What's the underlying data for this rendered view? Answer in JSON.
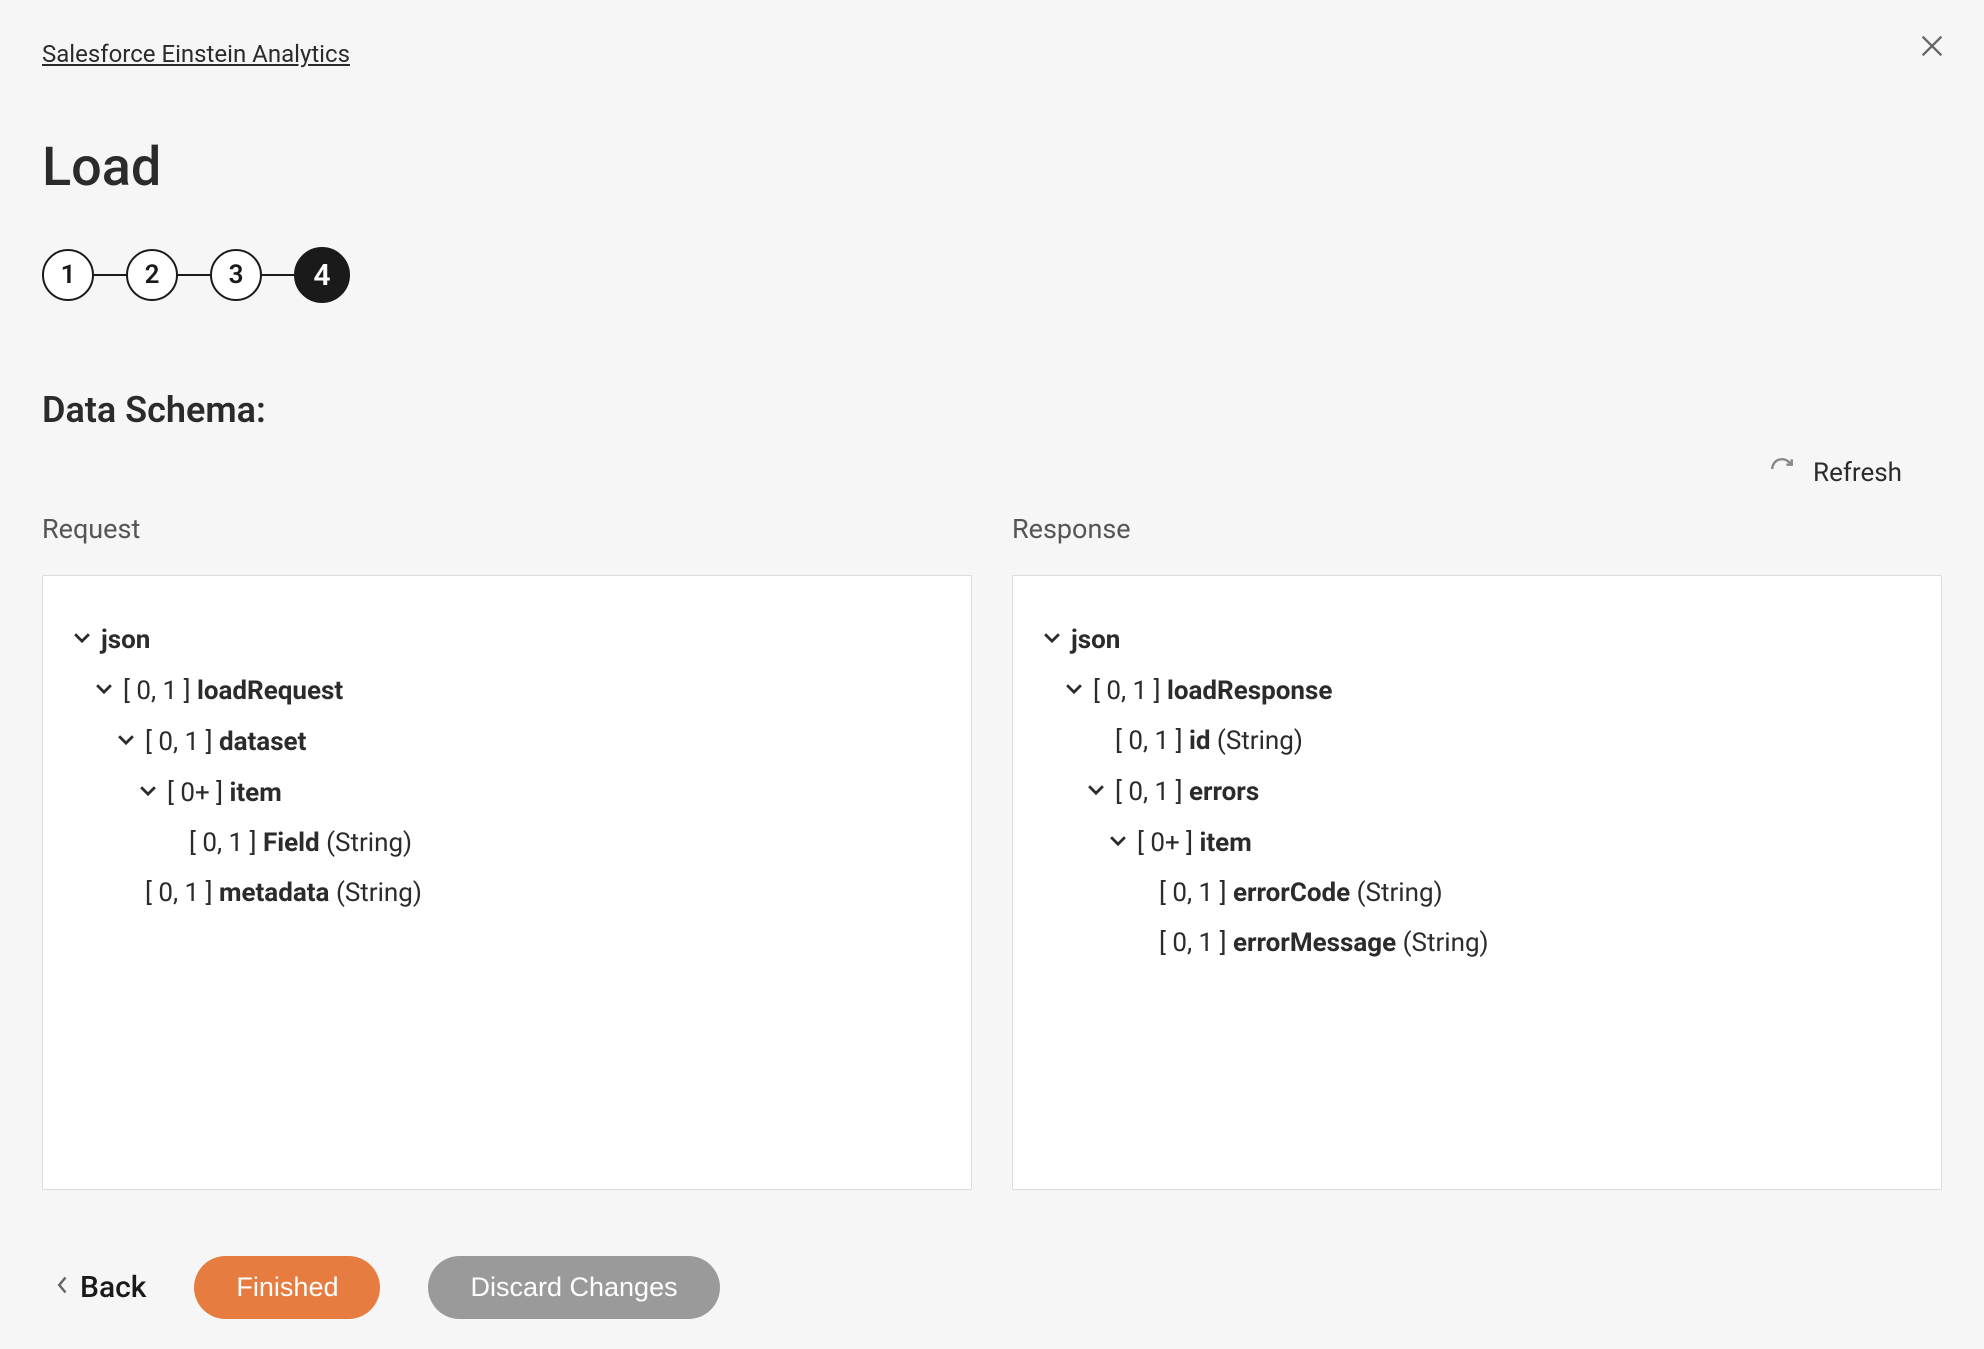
{
  "breadcrumb": "Salesforce Einstein Analytics",
  "title": "Load",
  "stepper": {
    "steps": [
      "1",
      "2",
      "3",
      "4"
    ],
    "active_index": 3
  },
  "section_title": "Data Schema:",
  "refresh_label": "Refresh",
  "columns": {
    "request": {
      "header": "Request",
      "tree": [
        {
          "indent": 0,
          "chevron": true,
          "card": "",
          "name": "json",
          "type": ""
        },
        {
          "indent": 1,
          "chevron": true,
          "card": "[ 0, 1 ]",
          "name": "loadRequest",
          "type": ""
        },
        {
          "indent": 2,
          "chevron": true,
          "card": "[ 0, 1 ]",
          "name": "dataset",
          "type": ""
        },
        {
          "indent": 3,
          "chevron": true,
          "card": "[ 0+ ]",
          "name": "item",
          "type": ""
        },
        {
          "indent": 4,
          "chevron": false,
          "card": "[ 0, 1 ]",
          "name": "Field",
          "type": "(String)"
        },
        {
          "indent": 2,
          "chevron": false,
          "card": "[ 0, 1 ]",
          "name": "metadata",
          "type": "(String)"
        }
      ]
    },
    "response": {
      "header": "Response",
      "tree": [
        {
          "indent": 0,
          "chevron": true,
          "card": "",
          "name": "json",
          "type": ""
        },
        {
          "indent": 1,
          "chevron": true,
          "card": "[ 0, 1 ]",
          "name": "loadResponse",
          "type": ""
        },
        {
          "indent": 2,
          "chevron": false,
          "card": "[ 0, 1 ]",
          "name": "id",
          "type": "(String)"
        },
        {
          "indent": 2,
          "chevron": true,
          "card": "[ 0, 1 ]",
          "name": "errors",
          "type": ""
        },
        {
          "indent": 3,
          "chevron": true,
          "card": "[ 0+ ]",
          "name": "item",
          "type": ""
        },
        {
          "indent": 4,
          "chevron": false,
          "card": "[ 0, 1 ]",
          "name": "errorCode",
          "type": "(String)"
        },
        {
          "indent": 4,
          "chevron": false,
          "card": "[ 0, 1 ]",
          "name": "errorMessage",
          "type": "(String)"
        }
      ]
    }
  },
  "footer": {
    "back": "Back",
    "finished": "Finished",
    "discard": "Discard Changes"
  }
}
